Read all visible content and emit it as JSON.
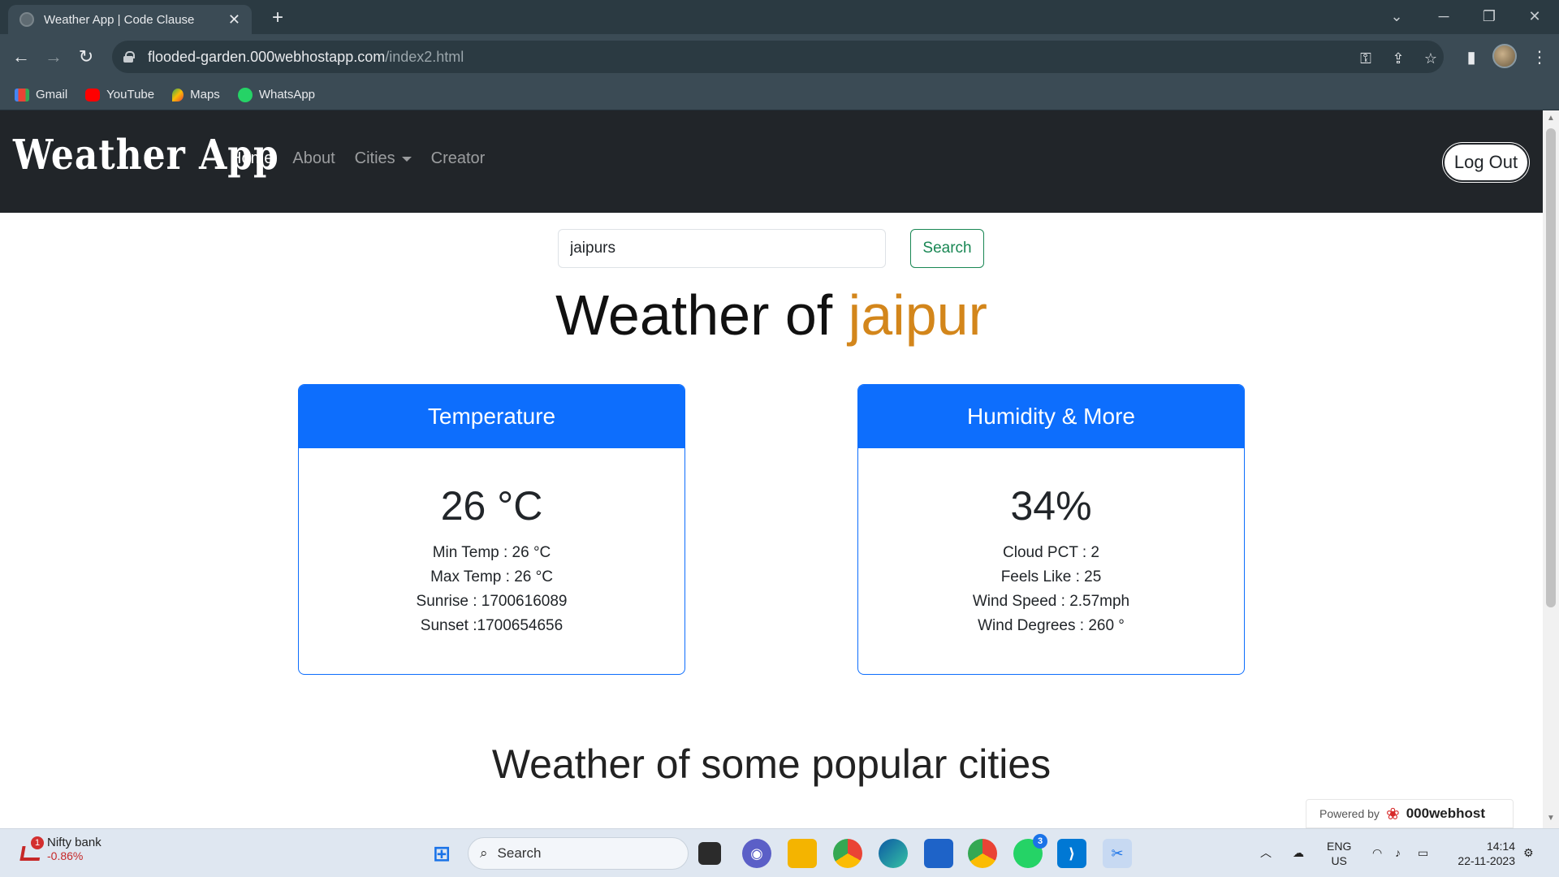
{
  "browser": {
    "tab_title": "Weather App | Code Clause",
    "url_host": "flooded-garden.000webhostapp.com",
    "url_path": "/index2.html",
    "bookmarks": [
      "Gmail",
      "YouTube",
      "Maps",
      "WhatsApp"
    ]
  },
  "navbar": {
    "brand": "Weather App",
    "links": [
      "Home",
      "About",
      "Cities",
      "Creator"
    ],
    "logout_label": "Log Out"
  },
  "search": {
    "value": "jaipurs",
    "button_label": "Search"
  },
  "headline": {
    "prefix": "Weather of ",
    "city": "jaipur",
    "city_color": "#d3861b"
  },
  "temperature_card": {
    "title": "Temperature",
    "main": "26 °C",
    "lines": [
      "Min Temp : 26 °C",
      "Max Temp : 26 °C",
      "Sunrise : 1700616089",
      "Sunset :1700654656"
    ]
  },
  "humidity_card": {
    "title": "Humidity & More",
    "main": "34%",
    "lines": [
      "Cloud PCT : 2",
      "Feels Like : 25",
      "Wind Speed : 2.57mph",
      "Wind Degrees : 260 °"
    ]
  },
  "subheadline": "Weather of some popular cities",
  "powered": {
    "prefix": "Powered by",
    "brand": "000webhost"
  },
  "taskbar": {
    "widget_title": "Nifty bank",
    "widget_value": "-0.86%",
    "widget_badge": "1",
    "search_label": "Search",
    "whatsapp_badge": "3",
    "lang_top": "ENG",
    "lang_bottom": "US",
    "time": "14:14",
    "date": "22-11-2023"
  },
  "colors": {
    "primary": "#0d6efd",
    "success": "#198754",
    "navbar": "#212529",
    "accent": "#d3861b"
  }
}
